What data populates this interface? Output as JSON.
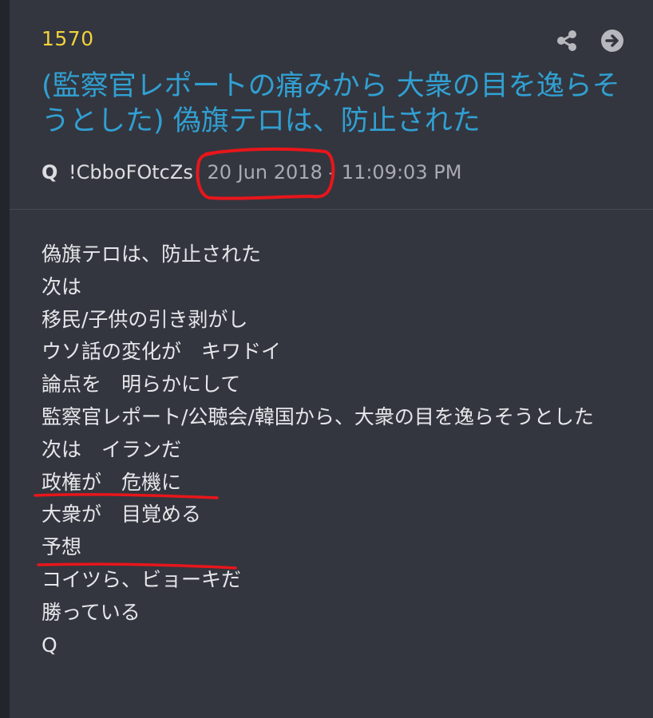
{
  "post": {
    "number": "1570",
    "title": "(監察官レポートの痛みから 大衆の目を逸らそうとした) 偽旗テロは、防止された",
    "author": "Q",
    "tripcode": "!CbboFOtcZs",
    "date": "20 Jun 2018",
    "separator": "-",
    "time": "11:09:03 PM",
    "body_lines": [
      "偽旗テロは、防止された",
      "次は",
      "移民/子供の引き剥がし",
      "ウソ話の変化が　キワドイ",
      "論点を　明らかにして",
      "監察官レポート/公聴会/韓国から、大衆の目を逸らそうとした",
      "次は　イランだ",
      "政権が　危機に",
      "大衆が　目覚める",
      "予想",
      "コイツら、ビョーキだ",
      "勝っている",
      "Q"
    ]
  },
  "icons": {
    "share": "share-icon",
    "next": "arrow-right-circle-icon"
  },
  "colors": {
    "background": "#33363f",
    "post_number": "#f2d23a",
    "title": "#31a0d2",
    "text": "#e6e7ea",
    "muted": "#a9abb1",
    "annotation": "#e8161b"
  }
}
